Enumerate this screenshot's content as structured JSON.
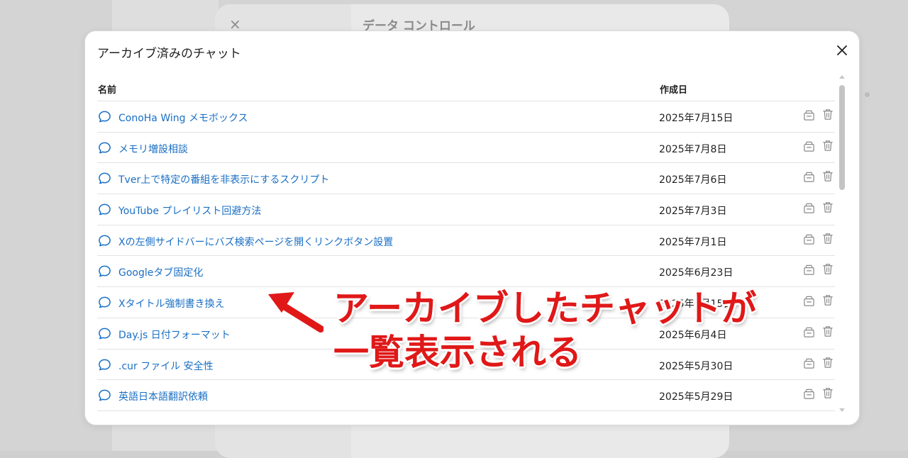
{
  "background": {
    "settings_title": "データ コントロール",
    "close_symbol": "×"
  },
  "modal": {
    "title": "アーカイブ済みのチャット",
    "close_icon": "close-icon",
    "columns": {
      "name": "名前",
      "date": "作成日"
    },
    "rows": [
      {
        "title": "ConoHa Wing メモボックス",
        "date": "2025年7月15日"
      },
      {
        "title": "メモリ増設相談",
        "date": "2025年7月8日"
      },
      {
        "title": "Tver上で特定の番組を非表示にするスクリプト",
        "date": "2025年7月6日"
      },
      {
        "title": "YouTube プレイリスト回避方法",
        "date": "2025年7月3日"
      },
      {
        "title": "Xの左側サイドバーにバズ検索ページを開くリンクボタン設置",
        "date": "2025年7月1日"
      },
      {
        "title": "Googleタブ固定化",
        "date": "2025年6月23日"
      },
      {
        "title": "Xタイトル強制書き換え",
        "date": "2025年6月15日"
      },
      {
        "title": "Day.js 日付フォーマット",
        "date": "2025年6月4日"
      },
      {
        "title": ".cur ファイル 安全性",
        "date": "2025年5月30日"
      },
      {
        "title": "英語日本語翻訳依頼",
        "date": "2025年5月29日"
      }
    ]
  },
  "annotation": {
    "line1": "アーカイブしたチャットが",
    "line2": "一覧表示される",
    "color": "#e01818"
  },
  "colors": {
    "link": "#1a6fc4",
    "accent": "#e01818"
  }
}
